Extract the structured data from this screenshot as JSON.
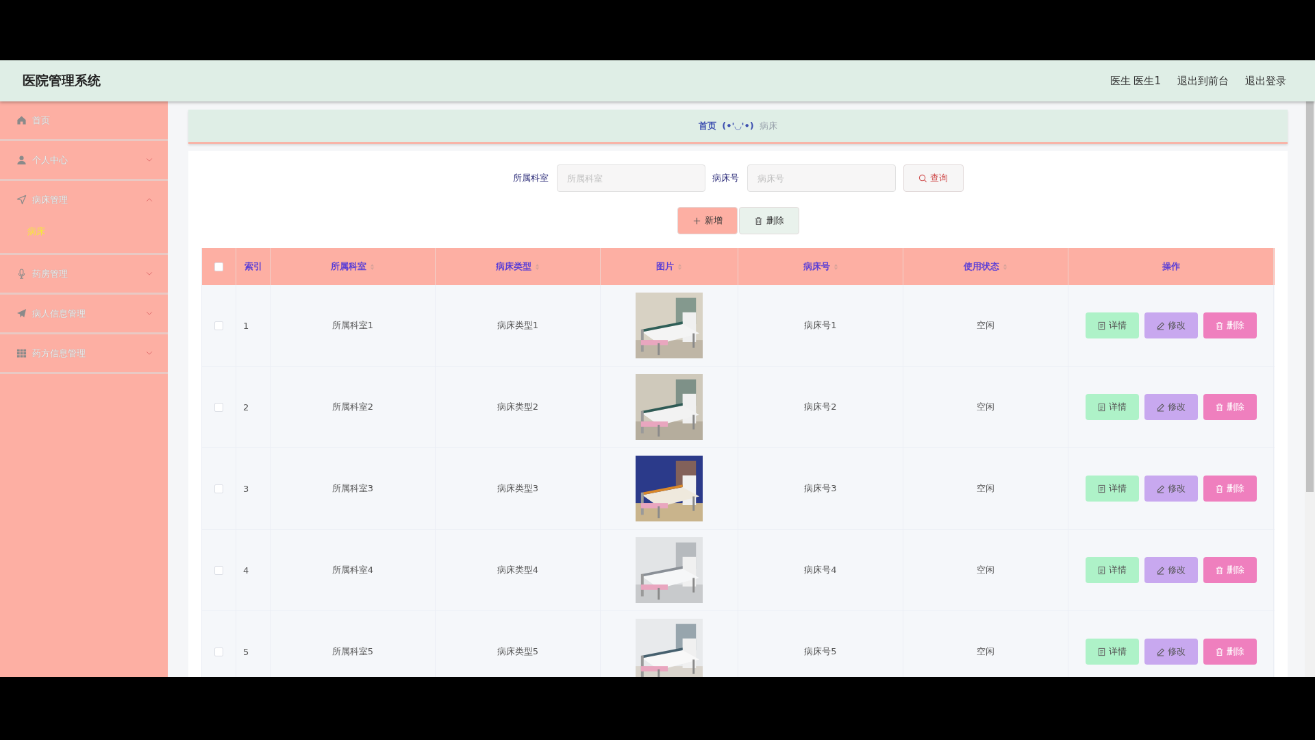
{
  "header": {
    "title": "医院管理系统",
    "links": [
      "医生 医生1",
      "退出到前台",
      "退出登录"
    ]
  },
  "sidebar": {
    "items": [
      {
        "label": "首页"
      },
      {
        "label": "个人中心",
        "expanded": false
      },
      {
        "label": "病床管理",
        "expanded": true,
        "children": [
          {
            "label": "病床",
            "selected": true
          }
        ]
      },
      {
        "label": "药房管理",
        "expanded": false
      },
      {
        "label": "病人信息管理",
        "expanded": false
      },
      {
        "label": "药方信息管理",
        "expanded": false
      }
    ]
  },
  "breadcrumb": {
    "home": "首页",
    "separator": "(•'◡'•)",
    "current": "病床"
  },
  "search": {
    "fields": [
      {
        "label": "所属科室",
        "placeholder": "所属科室"
      },
      {
        "label": "病床号",
        "placeholder": "病床号"
      }
    ],
    "button": "查询"
  },
  "actions": [
    {
      "kind": "add",
      "label": "新增"
    },
    {
      "kind": "delete",
      "label": "删除"
    }
  ],
  "table": {
    "select_all": {
      "checked": false
    },
    "columns": [
      {
        "label": "索引",
        "sortable": false
      },
      {
        "label": "所属科室",
        "sortable": true
      },
      {
        "label": "病床类型",
        "sortable": true
      },
      {
        "label": "图片",
        "sortable": true
      },
      {
        "label": "病床号",
        "sortable": true
      },
      {
        "label": "使用状态",
        "sortable": true
      },
      {
        "label": "操作",
        "sortable": false
      }
    ],
    "rows": [
      {
        "checked": false,
        "index": "1",
        "department": "所属科室1",
        "bed_type": "病床类型1",
        "bed_no": "病床号1",
        "status": "空闲",
        "actions": [
          {
            "kind": "detail",
            "label": "详情"
          },
          {
            "kind": "edit",
            "label": "修改"
          },
          {
            "kind": "delete",
            "label": "删除"
          }
        ]
      },
      {
        "checked": false,
        "index": "2",
        "department": "所属科室2",
        "bed_type": "病床类型2",
        "bed_no": "病床号2",
        "status": "空闲",
        "actions": [
          {
            "kind": "detail",
            "label": "详情"
          },
          {
            "kind": "edit",
            "label": "修改"
          },
          {
            "kind": "delete",
            "label": "删除"
          }
        ]
      },
      {
        "checked": false,
        "index": "3",
        "department": "所属科室3",
        "bed_type": "病床类型3",
        "bed_no": "病床号3",
        "status": "空闲",
        "actions": [
          {
            "kind": "detail",
            "label": "详情"
          },
          {
            "kind": "edit",
            "label": "修改"
          },
          {
            "kind": "delete",
            "label": "删除"
          }
        ]
      },
      {
        "checked": false,
        "index": "4",
        "department": "所属科室4",
        "bed_type": "病床类型4",
        "bed_no": "病床号4",
        "status": "空闲",
        "actions": [
          {
            "kind": "detail",
            "label": "详情"
          },
          {
            "kind": "edit",
            "label": "修改"
          },
          {
            "kind": "delete",
            "label": "删除"
          }
        ]
      },
      {
        "checked": false,
        "index": "5",
        "department": "所属科室5",
        "bed_type": "病床类型5",
        "bed_no": "病床号5",
        "status": "空闲",
        "actions": [
          {
            "kind": "detail",
            "label": "详情"
          },
          {
            "kind": "edit",
            "label": "修改"
          },
          {
            "kind": "delete",
            "label": "删除"
          }
        ]
      }
    ]
  }
}
